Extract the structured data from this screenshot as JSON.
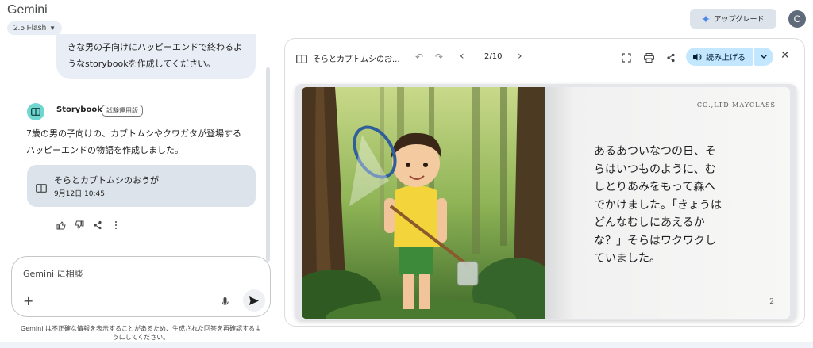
{
  "header": {
    "brand": "Gemini",
    "model": "2.5 Flash",
    "upgrade_label": "アップグレード",
    "avatar_initial": "C"
  },
  "chat": {
    "user_message_line1": "きな男の子向けにハッピーエンドで終わるよ",
    "user_message_line2": "うなstorybookを作成してください。",
    "bot_name": "Storybook",
    "bot_badge": "試験運用版",
    "reply_line1": "7歳の男の子向けの、カブトムシやクワガタが登場する",
    "reply_line2": "ハッピーエンドの物語を作成しました。",
    "card_title": "そらとカブトムシのおうが",
    "card_date": "9月12日 10:45"
  },
  "composer": {
    "placeholder": "Gemini に相談",
    "disclaimer_line1": "Gemini は不正確な情報を表示することがあるため、生成された回答を再確認するよ",
    "disclaimer_line2": "うにしてください。"
  },
  "storybook": {
    "title": "そらとカブトムシのお...",
    "page_indicator": "2/10",
    "read_aloud_label": "読み上げる",
    "publisher": "CO.,LTD MAYCLASS",
    "story_lines": [
      "あるあついなつの日、そ",
      "らはいつものように、む",
      "しとりあみをもって森へ",
      "でかけました。「きょうは",
      "どんなむしにあえるか",
      "な？」そらはワクワクし",
      "ていました。"
    ],
    "page_number": "2"
  },
  "colors": {
    "accent_read": "#c2e7ff",
    "bubble": "#e9eef6",
    "card": "#dde3ea"
  }
}
